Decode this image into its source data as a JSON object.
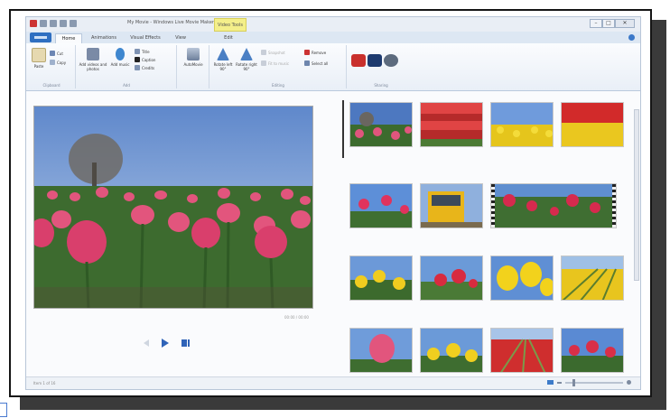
{
  "window": {
    "title": "My Movie - Windows Live Movie Maker",
    "context_tab": "Video Tools",
    "controls": {
      "minimize": "–",
      "maximize": "□",
      "close": "✕"
    }
  },
  "tabs": [
    "Home",
    "Animations",
    "Visual Effects",
    "View",
    "Edit"
  ],
  "ribbon": {
    "clipboard": {
      "label": "Clipboard",
      "paste": "Paste",
      "cut": "Cut",
      "copy": "Copy"
    },
    "add": {
      "label": "Add",
      "add_videos": "Add videos and photos",
      "add_music": "Add music",
      "title": "Title",
      "caption": "Caption",
      "credits": "Credits"
    },
    "automovie": "AutoMovie",
    "editing": {
      "label": "Editing",
      "rotate_left": "Rotate left 90°",
      "rotate_right": "Rotate right 90°",
      "remove": "Remove",
      "select_all": "Select all",
      "snapshot": "Snapshot",
      "fit_to": "Fit to music"
    },
    "sharing": {
      "label": "Sharing"
    }
  },
  "preview": {
    "time": "00:00 / 00:00"
  },
  "status": {
    "text": "Item 1 of 16"
  },
  "colors": {
    "accent": "#2f6fc1",
    "context_tab": "#f4ef8a"
  }
}
